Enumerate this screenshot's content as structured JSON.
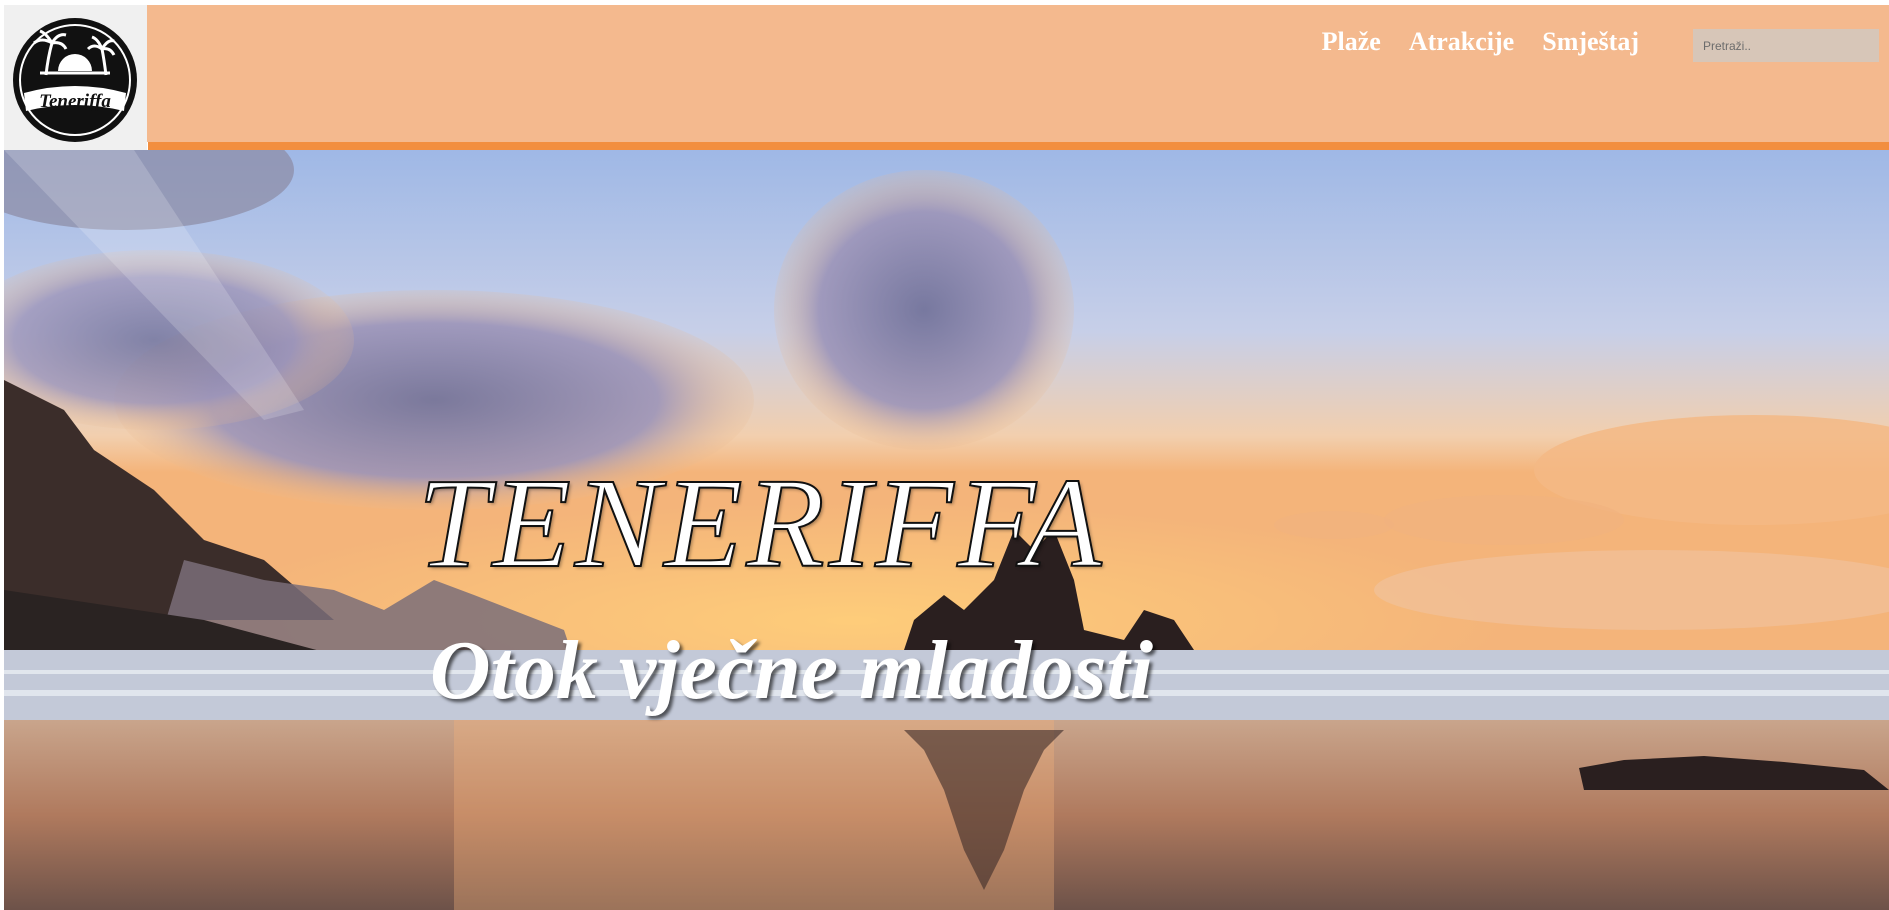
{
  "header": {
    "logo": {
      "text": "Teneriffa",
      "icon": "palm-trees-sun-logo-icon"
    },
    "nav": [
      {
        "label": "Plaže"
      },
      {
        "label": "Atrakcije"
      },
      {
        "label": "Smještaj"
      }
    ],
    "search": {
      "placeholder": "Pretraži..",
      "value": ""
    }
  },
  "hero": {
    "title": "TENERIFFA",
    "subtitle": "Otok vječne mladosti",
    "image": "sunset-beach-image"
  },
  "colors": {
    "header_bg": "#f4b98e",
    "header_stripe": "#f28e3f",
    "nav_text": "#ffffff",
    "search_bg": "#d7c6b8"
  }
}
